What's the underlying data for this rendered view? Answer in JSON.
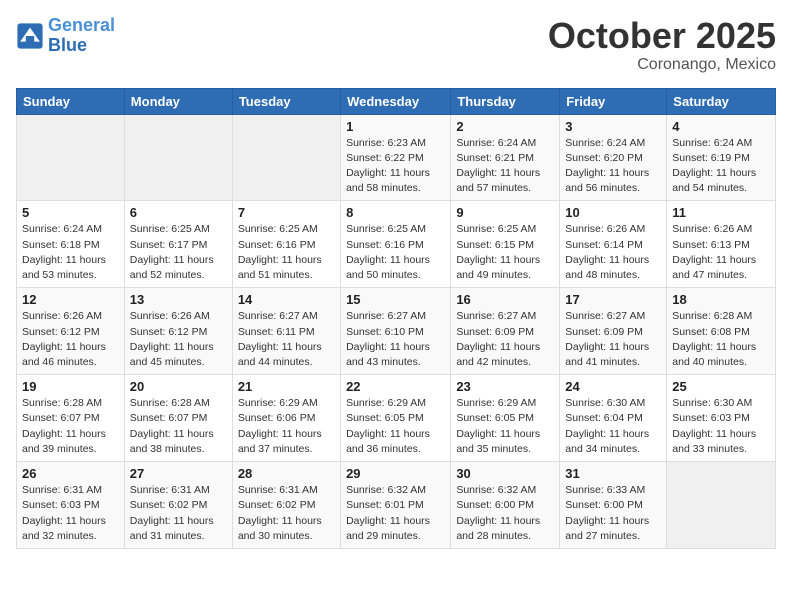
{
  "logo": {
    "line1": "General",
    "line2": "Blue"
  },
  "title": "October 2025",
  "subtitle": "Coronango, Mexico",
  "days_of_week": [
    "Sunday",
    "Monday",
    "Tuesday",
    "Wednesday",
    "Thursday",
    "Friday",
    "Saturday"
  ],
  "weeks": [
    [
      {
        "day": "",
        "info": ""
      },
      {
        "day": "",
        "info": ""
      },
      {
        "day": "",
        "info": ""
      },
      {
        "day": "1",
        "info": "Sunrise: 6:23 AM\nSunset: 6:22 PM\nDaylight: 11 hours\nand 58 minutes."
      },
      {
        "day": "2",
        "info": "Sunrise: 6:24 AM\nSunset: 6:21 PM\nDaylight: 11 hours\nand 57 minutes."
      },
      {
        "day": "3",
        "info": "Sunrise: 6:24 AM\nSunset: 6:20 PM\nDaylight: 11 hours\nand 56 minutes."
      },
      {
        "day": "4",
        "info": "Sunrise: 6:24 AM\nSunset: 6:19 PM\nDaylight: 11 hours\nand 54 minutes."
      }
    ],
    [
      {
        "day": "5",
        "info": "Sunrise: 6:24 AM\nSunset: 6:18 PM\nDaylight: 11 hours\nand 53 minutes."
      },
      {
        "day": "6",
        "info": "Sunrise: 6:25 AM\nSunset: 6:17 PM\nDaylight: 11 hours\nand 52 minutes."
      },
      {
        "day": "7",
        "info": "Sunrise: 6:25 AM\nSunset: 6:16 PM\nDaylight: 11 hours\nand 51 minutes."
      },
      {
        "day": "8",
        "info": "Sunrise: 6:25 AM\nSunset: 6:16 PM\nDaylight: 11 hours\nand 50 minutes."
      },
      {
        "day": "9",
        "info": "Sunrise: 6:25 AM\nSunset: 6:15 PM\nDaylight: 11 hours\nand 49 minutes."
      },
      {
        "day": "10",
        "info": "Sunrise: 6:26 AM\nSunset: 6:14 PM\nDaylight: 11 hours\nand 48 minutes."
      },
      {
        "day": "11",
        "info": "Sunrise: 6:26 AM\nSunset: 6:13 PM\nDaylight: 11 hours\nand 47 minutes."
      }
    ],
    [
      {
        "day": "12",
        "info": "Sunrise: 6:26 AM\nSunset: 6:12 PM\nDaylight: 11 hours\nand 46 minutes."
      },
      {
        "day": "13",
        "info": "Sunrise: 6:26 AM\nSunset: 6:12 PM\nDaylight: 11 hours\nand 45 minutes."
      },
      {
        "day": "14",
        "info": "Sunrise: 6:27 AM\nSunset: 6:11 PM\nDaylight: 11 hours\nand 44 minutes."
      },
      {
        "day": "15",
        "info": "Sunrise: 6:27 AM\nSunset: 6:10 PM\nDaylight: 11 hours\nand 43 minutes."
      },
      {
        "day": "16",
        "info": "Sunrise: 6:27 AM\nSunset: 6:09 PM\nDaylight: 11 hours\nand 42 minutes."
      },
      {
        "day": "17",
        "info": "Sunrise: 6:27 AM\nSunset: 6:09 PM\nDaylight: 11 hours\nand 41 minutes."
      },
      {
        "day": "18",
        "info": "Sunrise: 6:28 AM\nSunset: 6:08 PM\nDaylight: 11 hours\nand 40 minutes."
      }
    ],
    [
      {
        "day": "19",
        "info": "Sunrise: 6:28 AM\nSunset: 6:07 PM\nDaylight: 11 hours\nand 39 minutes."
      },
      {
        "day": "20",
        "info": "Sunrise: 6:28 AM\nSunset: 6:07 PM\nDaylight: 11 hours\nand 38 minutes."
      },
      {
        "day": "21",
        "info": "Sunrise: 6:29 AM\nSunset: 6:06 PM\nDaylight: 11 hours\nand 37 minutes."
      },
      {
        "day": "22",
        "info": "Sunrise: 6:29 AM\nSunset: 6:05 PM\nDaylight: 11 hours\nand 36 minutes."
      },
      {
        "day": "23",
        "info": "Sunrise: 6:29 AM\nSunset: 6:05 PM\nDaylight: 11 hours\nand 35 minutes."
      },
      {
        "day": "24",
        "info": "Sunrise: 6:30 AM\nSunset: 6:04 PM\nDaylight: 11 hours\nand 34 minutes."
      },
      {
        "day": "25",
        "info": "Sunrise: 6:30 AM\nSunset: 6:03 PM\nDaylight: 11 hours\nand 33 minutes."
      }
    ],
    [
      {
        "day": "26",
        "info": "Sunrise: 6:31 AM\nSunset: 6:03 PM\nDaylight: 11 hours\nand 32 minutes."
      },
      {
        "day": "27",
        "info": "Sunrise: 6:31 AM\nSunset: 6:02 PM\nDaylight: 11 hours\nand 31 minutes."
      },
      {
        "day": "28",
        "info": "Sunrise: 6:31 AM\nSunset: 6:02 PM\nDaylight: 11 hours\nand 30 minutes."
      },
      {
        "day": "29",
        "info": "Sunrise: 6:32 AM\nSunset: 6:01 PM\nDaylight: 11 hours\nand 29 minutes."
      },
      {
        "day": "30",
        "info": "Sunrise: 6:32 AM\nSunset: 6:00 PM\nDaylight: 11 hours\nand 28 minutes."
      },
      {
        "day": "31",
        "info": "Sunrise: 6:33 AM\nSunset: 6:00 PM\nDaylight: 11 hours\nand 27 minutes."
      },
      {
        "day": "",
        "info": ""
      }
    ]
  ]
}
